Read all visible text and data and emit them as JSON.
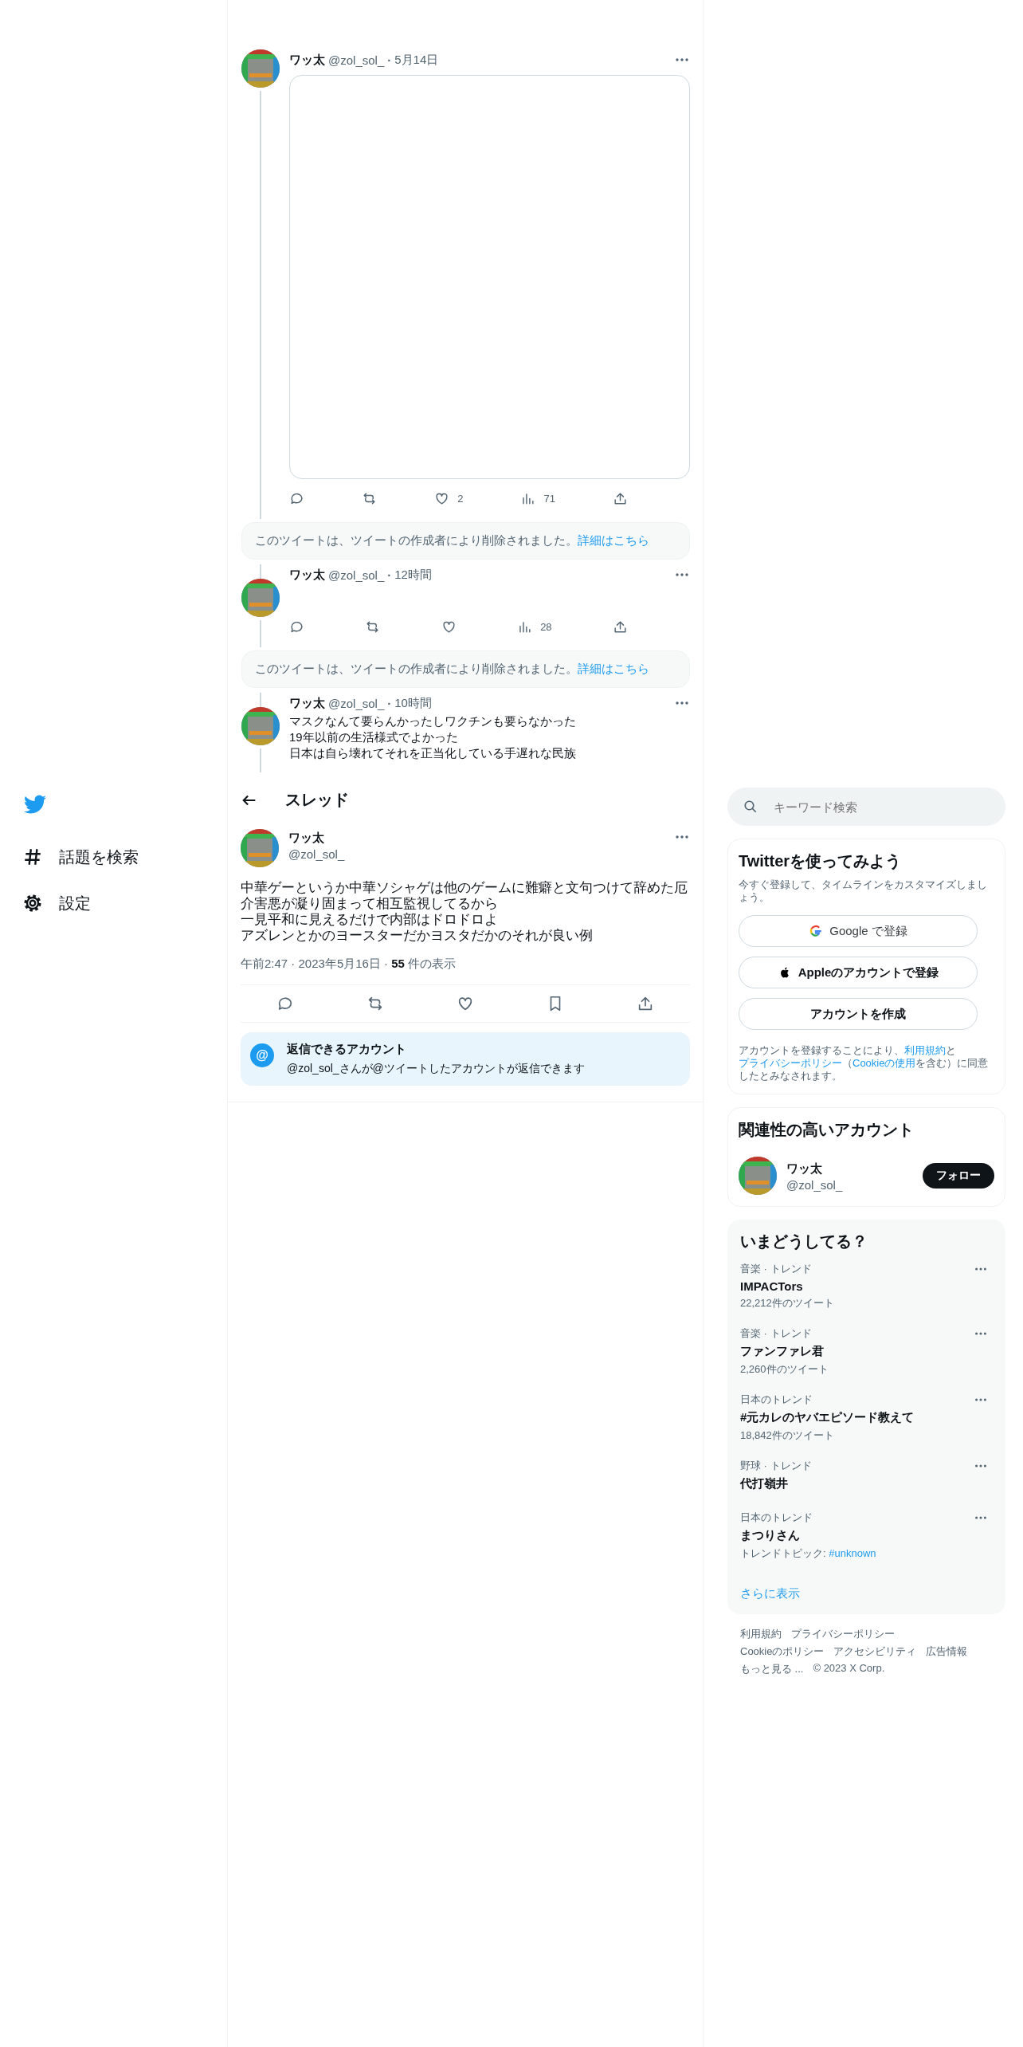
{
  "thread": [
    {
      "kind": "media",
      "name": "ワッ太",
      "handle": "@zol_sol_",
      "separator": "·",
      "time": "5月14日",
      "actions": [
        {
          "kind": "reply"
        },
        {
          "kind": "retweet"
        },
        {
          "kind": "like",
          "count": "2"
        },
        {
          "kind": "views",
          "count": "71"
        },
        {
          "kind": "share"
        }
      ]
    },
    {
      "kind": "notice",
      "text": "このツイートは、ツイートの作成者により削除されました。",
      "link": "詳細はこちら"
    },
    {
      "kind": "empty",
      "name": "ワッ太",
      "handle": "@zol_sol_",
      "separator": "·",
      "time": "12時間",
      "actions": [
        {
          "kind": "reply"
        },
        {
          "kind": "retweet"
        },
        {
          "kind": "like"
        },
        {
          "kind": "views",
          "count": "28"
        },
        {
          "kind": "share"
        }
      ]
    },
    {
      "kind": "notice",
      "text": "このツイートは、ツイートの作成者により削除されました。",
      "link": "詳細はこちら"
    },
    {
      "kind": "text",
      "name": "ワッ太",
      "handle": "@zol_sol_",
      "separator": "·",
      "time": "10時間",
      "lines": [
        "マスクなんて要らんかったしワクチンも要らなかった",
        "19年以前の生活様式でよかった",
        "日本は自ら壊れてそれを正当化している手遅れな民族"
      ]
    }
  ],
  "header": {
    "title": "スレッド"
  },
  "main": {
    "name": "ワッ太",
    "handle": "@zol_sol_",
    "lines": [
      "中華ゲーというか中華ソシャゲは他のゲームに難癖と文句つけて辞めた厄介害悪が凝り固まって相互監視してるから",
      "一見平和に見えるだけで内部はドロドロよ",
      "アズレンとかのヨースターだかヨスタだかのそれが良い例"
    ],
    "meta": "午前2:47 · 2023年5月16日 · **55** 件の表示",
    "actions": [
      {
        "kind": "reply"
      },
      {
        "kind": "retweet"
      },
      {
        "kind": "like"
      },
      {
        "kind": "bookmark"
      },
      {
        "kind": "share"
      }
    ],
    "reply_policy": {
      "icon": "@",
      "title": "返信できるアカウント",
      "description": "@zol_sol_さんが@ツイートしたアカウントが返信できます"
    }
  },
  "sidebar": {
    "items": [
      {
        "kind": "hash",
        "label": "話題を検索"
      },
      {
        "kind": "gear",
        "label": "設定"
      }
    ]
  },
  "search": {
    "placeholder": "キーワード検索"
  },
  "signup": {
    "title": "Twitterを使ってみよう",
    "subtitle": "今すぐ登録して、タイムラインをカスタマイズしましょう。",
    "buttons": [
      {
        "kind": "google",
        "label": "Google で登録"
      },
      {
        "kind": "apple",
        "label": "Appleのアカウントで登録"
      },
      {
        "kind": "create",
        "label": "アカウントを作成"
      }
    ],
    "legal": [
      {
        "kind": "text",
        "text": "アカウントを登録することにより、"
      },
      {
        "kind": "link",
        "text": "利用規約"
      },
      {
        "kind": "text",
        "text": "と"
      },
      {
        "kind": "link",
        "text": "プライバシーポリシー"
      },
      {
        "kind": "text",
        "text": "（"
      },
      {
        "kind": "link",
        "text": "Cookieの使用"
      },
      {
        "kind": "text",
        "text": "を含む）に同意したとみなされます。"
      }
    ]
  },
  "related": {
    "title": "関連性の高いアカウント",
    "accounts": [
      {
        "name": "ワッ太",
        "handle": "@zol_sol_",
        "button": "フォロー"
      }
    ]
  },
  "trends": {
    "title": "いまどうしてる？",
    "items": [
      {
        "context": "音楽 · トレンド",
        "name": "IMPACTors",
        "meta": "22,212件のツイート"
      },
      {
        "context": "音楽 · トレンド",
        "name": "ファンファレ君",
        "meta": "2,260件のツイート"
      },
      {
        "context": "日本のトレンド",
        "name": "#元カレのヤバエピソード教えて",
        "meta": "18,842件のツイート"
      },
      {
        "context": "野球 · トレンド",
        "name": "代打嶺井"
      },
      {
        "context": "日本のトレンド",
        "name": "まつりさん",
        "meta": "トレンドトピック:",
        "topic": "#unknown"
      }
    ],
    "more": "さらに表示"
  },
  "footer": [
    [
      "利用規約",
      "プライバシーポリシー"
    ],
    [
      "Cookieのポリシー",
      "アクセシビリティ",
      "広告情報"
    ],
    [
      "もっと見る ...",
      "© 2023 X Corp."
    ]
  ]
}
